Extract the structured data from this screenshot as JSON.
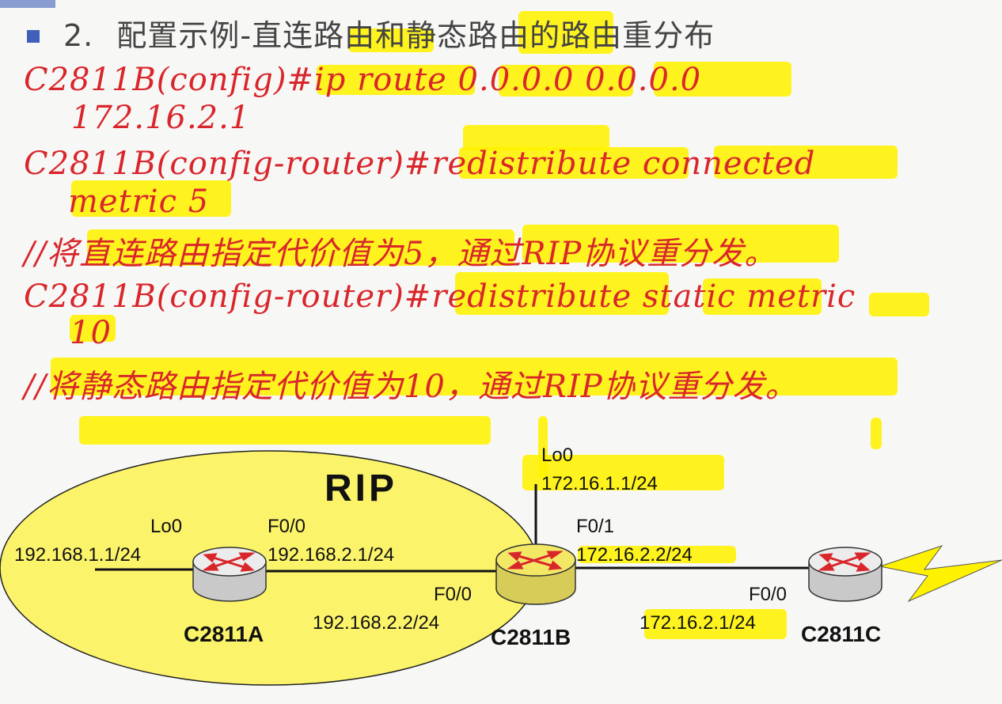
{
  "header": {
    "number": "2.",
    "title": "配置示例-直连路由和静态路由的路由重分布"
  },
  "commands": [
    {
      "prompt": "C2811B(config)#",
      "command": "ip route 0.0.0.0 0.0.0.0",
      "continuation": "172.16.2.1"
    },
    {
      "prompt": "C2811B(config-router)#",
      "command": "redistribute connected",
      "continuation": "metric 5"
    },
    {
      "comment": "//将直连路由指定代价值为5，通过RIP协议重分发。"
    },
    {
      "prompt": "C2811B(config-router)#",
      "command": "redistribute static metric",
      "continuation": "10"
    },
    {
      "comment": "//将静态路由指定代价值为10，通过RIP协议重分发。"
    }
  ],
  "diagram": {
    "rip_label": "RIP",
    "routers": [
      {
        "name": "C2811A"
      },
      {
        "name": "C2811B"
      },
      {
        "name": "C2811C"
      }
    ],
    "interfaces": {
      "a_lo0_name": "Lo0",
      "a_lo0_ip": "192.168.1.1/24",
      "a_f00_name": "F0/0",
      "a_f00_ip": "192.168.2.1/24",
      "b_f00_name": "F0/0",
      "b_f00_ip": "192.168.2.2/24",
      "b_lo0_name": "Lo0",
      "b_lo0_ip": "172.16.1.1/24",
      "b_f01_name": "F0/1",
      "b_f01_ip": "172.16.2.2/24",
      "c_f00_name": "F0/0",
      "c_f00_ip": "172.16.2.1/24"
    },
    "colors": {
      "highlight": "#fff200",
      "rip_area": "#fbf36a",
      "command_text": "#d9262b",
      "router_arrows": "#d9262b"
    }
  }
}
